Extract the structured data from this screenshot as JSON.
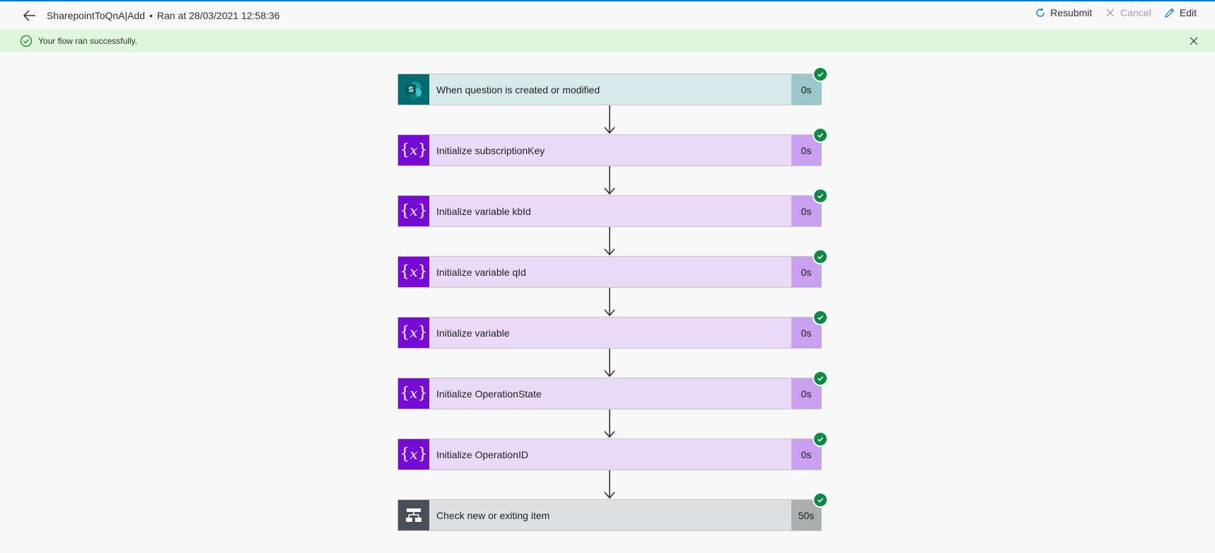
{
  "header": {
    "flow_name": "SharepointToQnA|Add",
    "separator": "•",
    "run_info": "Ran at 28/03/2021 12:58:36",
    "actions": {
      "resubmit": "Resubmit",
      "cancel": "Cancel",
      "edit": "Edit"
    }
  },
  "banner": {
    "message": "Your flow ran successfully.",
    "status_color": "#0c8a43"
  },
  "steps": [
    {
      "label": "When question is created or modified",
      "duration": "0s",
      "type": "sharepoint-trigger",
      "icon": "sharepoint-icon",
      "icon_text": "S",
      "status": "succeeded"
    },
    {
      "label": "Initialize subscriptionKey",
      "duration": "0s",
      "type": "variable",
      "icon": "variable-icon",
      "status": "succeeded"
    },
    {
      "label": "Initialize variable kbId",
      "duration": "0s",
      "type": "variable",
      "icon": "variable-icon",
      "status": "succeeded"
    },
    {
      "label": "Initialize variable qId",
      "duration": "0s",
      "type": "variable",
      "icon": "variable-icon",
      "status": "succeeded"
    },
    {
      "label": "Initialize variable",
      "duration": "0s",
      "type": "variable",
      "icon": "variable-icon",
      "status": "succeeded"
    },
    {
      "label": "Initialize OperationState",
      "duration": "0s",
      "type": "variable",
      "icon": "variable-icon",
      "status": "succeeded"
    },
    {
      "label": "Initialize OperationID",
      "duration": "0s",
      "type": "variable",
      "icon": "variable-icon",
      "status": "succeeded"
    },
    {
      "label": "Check new or exiting item",
      "duration": "50s",
      "type": "condition",
      "icon": "condition-icon",
      "status": "succeeded"
    }
  ],
  "colors": {
    "accent": "#0078d4",
    "success": "#0c8a43",
    "variable": "#770bd6",
    "sharepoint": "#036c70",
    "condition": "#484f58"
  }
}
